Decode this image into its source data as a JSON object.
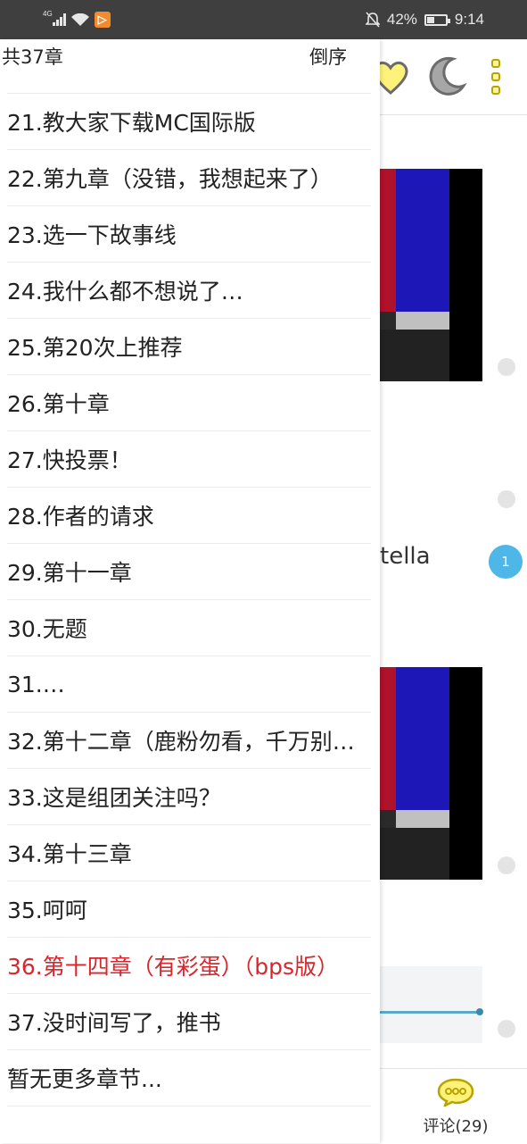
{
  "status_bar": {
    "network": "4G",
    "battery": "42%",
    "battery_level": 0.42,
    "time": "9:14"
  },
  "drawer": {
    "chapter_count": "共37章",
    "reverse_label": "倒序",
    "chapters": [
      {
        "label": "21.教大家下载MC国际版",
        "current": false
      },
      {
        "label": "22.第九章（没错，我想起来了）",
        "current": false
      },
      {
        "label": "23.选一下故事线",
        "current": false
      },
      {
        "label": "24.我什么都不想说了…",
        "current": false
      },
      {
        "label": "25.第20次上推荐",
        "current": false
      },
      {
        "label": "26.第十章",
        "current": false
      },
      {
        "label": "27.快投票！",
        "current": false
      },
      {
        "label": "28.作者的请求",
        "current": false
      },
      {
        "label": "29.第十一章",
        "current": false
      },
      {
        "label": "30.无题",
        "current": false
      },
      {
        "label": "31.…",
        "current": false
      },
      {
        "label": "32.第十二章（鹿粉勿看，千万别…",
        "current": false
      },
      {
        "label": "33.这是组团关注吗？",
        "current": false
      },
      {
        "label": "34.第十三章",
        "current": false
      },
      {
        "label": "35.呵呵",
        "current": false
      },
      {
        "label": "36.第十四章（有彩蛋）（bps版）",
        "current": true
      },
      {
        "label": "37.没时间写了，推书",
        "current": false
      },
      {
        "label": "暂无更多章节...",
        "current": false
      }
    ],
    "accent_color": "#d8262c"
  },
  "background": {
    "partial_text": "tella",
    "badge_count": "1",
    "comments_label": "评论(29)"
  }
}
